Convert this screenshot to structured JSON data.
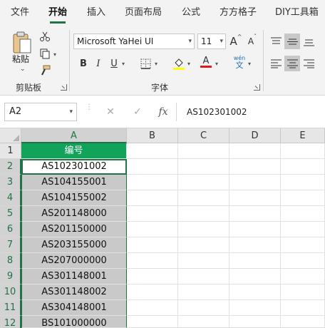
{
  "tabs": [
    "文件",
    "开始",
    "插入",
    "页面布局",
    "公式",
    "方方格子",
    "DIY工具箱"
  ],
  "ribbon": {
    "clipboard": {
      "paste_label": "粘贴",
      "group_label": "剪贴板"
    },
    "font": {
      "font_name": "Microsoft YaHei UI",
      "font_size": "11",
      "bold": "B",
      "italic": "I",
      "underline": "U",
      "grow": "A",
      "shrink": "A",
      "font_color_glyph": "A",
      "phonetic_top": "wén",
      "phonetic_bottom": "文",
      "group_label": "字体"
    }
  },
  "formula_bar": {
    "name_box": "A2",
    "cancel_glyph": "✕",
    "enter_glyph": "✓",
    "fx_glyph": "fx",
    "content": "AS102301002"
  },
  "grid": {
    "columns": [
      "A",
      "B",
      "C",
      "D",
      "E"
    ],
    "rows": [
      "1",
      "2",
      "3",
      "4",
      "5",
      "6",
      "7",
      "8",
      "9",
      "10",
      "11",
      "12"
    ],
    "column_a": [
      "编号",
      "AS102301002",
      "AS104155001",
      "AS104155002",
      "AS201148000",
      "AS201150000",
      "AS203155000",
      "AS207000000",
      "AS301148001",
      "AS301148002",
      "AS304148001",
      "BS101000000"
    ]
  },
  "colors": {
    "accent": "#217346",
    "header_fill": "#11a35a",
    "selection_fill": "#c9c9c9"
  }
}
